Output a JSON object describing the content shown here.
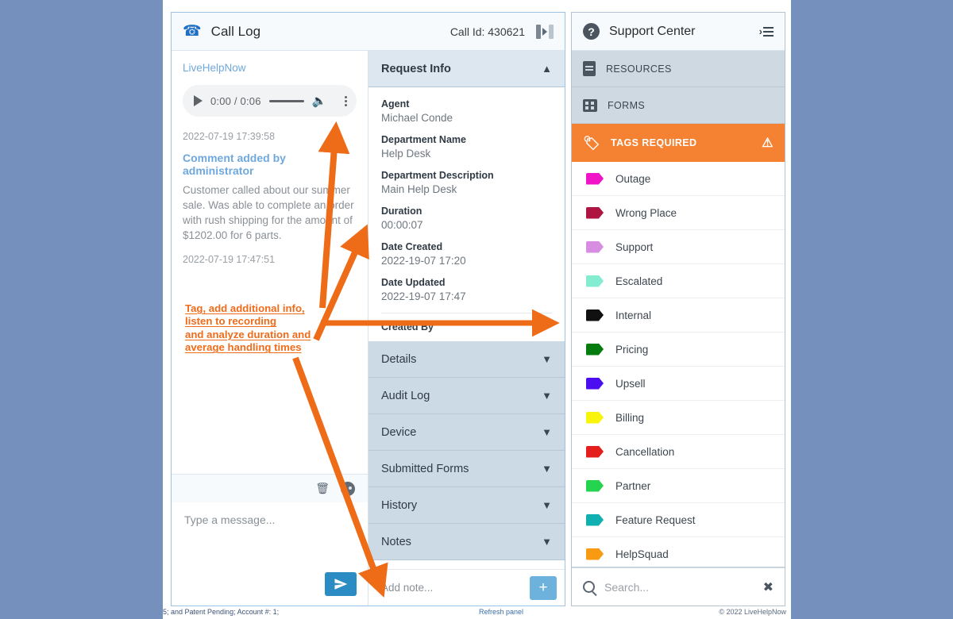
{
  "call_log": {
    "header": {
      "title": "Call Log",
      "phone_icon": "phone-icon",
      "call_id_label": "Call Id: 430621",
      "toggle_icon": "panel-toggle-icon"
    },
    "transcript": {
      "brand": "LiveHelpNow",
      "audio": {
        "play_icon": "play-icon",
        "time": "0:00 / 0:06",
        "volume_icon": "volume-icon",
        "menu_icon": "more-vertical-icon"
      },
      "entries": [
        {
          "timestamp": "2022-07-19 17:39:58"
        },
        {
          "title": "Comment added by administrator",
          "body": "Customer called about our summer sale. Was able to complete an order with rush shipping for the amount of $1202.00 for 6 parts."
        },
        {
          "timestamp": "2022-07-19 17:47:51"
        }
      ]
    },
    "composer": {
      "trash_icon": "trash-icon",
      "emoji_icon": "emoji-icon",
      "placeholder": "Type a message...",
      "value": "",
      "send_icon": "send-icon"
    }
  },
  "request_info": {
    "section_title": "Request Info",
    "expanded": true,
    "chevron_up": "⌃",
    "fields": [
      {
        "label": "Agent",
        "value": "Michael Conde"
      },
      {
        "label": "Department Name",
        "value": "Help Desk"
      },
      {
        "label": "Department Description",
        "value": "Main Help Desk"
      },
      {
        "label": "Duration",
        "value": "00:00:07"
      },
      {
        "label": "Date Created",
        "value": "2022-19-07 17:20"
      },
      {
        "label": "Date Updated",
        "value": "2022-19-07 17:47"
      }
    ],
    "trailing_label": "Created By"
  },
  "accordion_sections": [
    {
      "label": "Details"
    },
    {
      "label": "Audit Log"
    },
    {
      "label": "Device"
    },
    {
      "label": "Submitted Forms"
    },
    {
      "label": "History"
    },
    {
      "label": "Notes"
    }
  ],
  "note_row": {
    "placeholder": "Add note...",
    "value": "",
    "add_label": "+"
  },
  "support_center": {
    "header": {
      "title": "Support Center",
      "help_icon": "question-mark-icon",
      "help_glyph": "?",
      "collapse_icon": "collapse-panel-icon"
    },
    "sections": [
      {
        "label": "RESOURCES",
        "icon": "document-icon"
      },
      {
        "label": "FORMS",
        "icon": "forms-grid-icon"
      }
    ],
    "tags_header": {
      "label": "TAGS REQUIRED",
      "icon": "tag-icon",
      "warning_icon": "warning-triangle-icon",
      "warning_glyph": "⚠",
      "background": "#f58233"
    },
    "tags": [
      {
        "label": "Outage",
        "color": "#f013c8"
      },
      {
        "label": "Wrong Place",
        "color": "#ae1540"
      },
      {
        "label": "Support",
        "color": "#d88ee0"
      },
      {
        "label": "Escalated",
        "color": "#84ecd0"
      },
      {
        "label": "Internal",
        "color": "#111111"
      },
      {
        "label": "Pricing",
        "color": "#047c10"
      },
      {
        "label": "Upsell",
        "color": "#4b0ef0"
      },
      {
        "label": "Billing",
        "color": "#f9f40c"
      },
      {
        "label": "Cancellation",
        "color": "#e41d1d"
      },
      {
        "label": "Partner",
        "color": "#24d44f"
      },
      {
        "label": "Feature Request",
        "color": "#11b0b0"
      },
      {
        "label": "HelpSquad",
        "color": "#f89a12"
      }
    ],
    "search": {
      "placeholder": "Search...",
      "value": "",
      "search_icon": "search-icon",
      "clear_icon": "close-icon",
      "clear_glyph": "✖"
    }
  },
  "footer": {
    "left": "5; and Patent Pending; Account #: 1;",
    "refresh_link": "Refresh panel",
    "copyright": "© 2022 LiveHelpNow"
  },
  "annotation": {
    "color": "#ef6c1a",
    "lines": [
      "Tag, add additional info,",
      "listen to recording",
      "and analyze duration and",
      "average handling times"
    ]
  }
}
